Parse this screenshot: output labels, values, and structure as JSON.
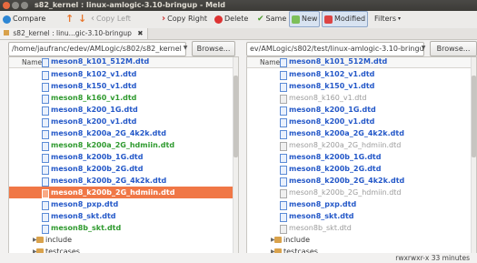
{
  "window": {
    "title": "s82_kernel : linux-amlogic-3.10-bringup - Meld"
  },
  "toolbar": {
    "compare": "Compare",
    "copy_left": "Copy Left",
    "copy_right": "Copy Right",
    "delete": "Delete",
    "same": "Same",
    "new": "New",
    "modified": "Modified",
    "filters": "Filters"
  },
  "tab": {
    "label": "s82_kernel : linu...gic-3.10-bringup",
    "close": "✖"
  },
  "left": {
    "path": "/home/jaufranc/edev/AMLogic/s802/s82_kernel",
    "browse": "Browse...",
    "column": "Name",
    "rows": [
      "meson8_k102_v1.dtd",
      "meson8_k150_v1.dtd",
      "meson8_k160_v1.dtd",
      "meson8_k200_1G.dtd",
      "meson8_k200_v1.dtd",
      "meson8_k200a_2G_4k2k.dtd",
      "meson8_k200a_2G_hdmiin.dtd",
      "meson8_k200b_1G.dtd",
      "meson8_k200b_2G.dtd",
      "meson8_k200b_2G_4k2k.dtd",
      "meson8_k200b_2G_hdmiin.dtd",
      "meson8_pxp.dtd",
      "meson8_skt.dtd",
      "meson8b_skt.dtd"
    ],
    "folders": [
      "include",
      "testcases"
    ]
  },
  "right": {
    "path": "ev/AMLogic/s802/test/linux-amlogic-3.10-bringup",
    "browse": "Browse...",
    "column": "Name",
    "rows": [
      "meson8_k102_v1.dtd",
      "meson8_k150_v1.dtd",
      "meson8_k160_v1.dtd",
      "meson8_k200_1G.dtd",
      "meson8_k200_v1.dtd",
      "meson8_k200a_2G_4k2k.dtd",
      "meson8_k200a_2G_hdmiin.dtd",
      "meson8_k200b_1G.dtd",
      "meson8_k200b_2G.dtd",
      "meson8_k200b_2G_4k2k.dtd",
      "meson8_k200b_2G_hdmiin.dtd",
      "meson8_pxp.dtd",
      "meson8_skt.dtd",
      "meson8b_skt.dtd"
    ],
    "folders": [
      "include",
      "testcases"
    ]
  },
  "status": {
    "text": "rwxrwxr-x  33 minutes"
  },
  "colors": {
    "selection": "#f07746",
    "blue": "#2458c8",
    "green": "#2f9a2f",
    "gray": "#9b9b9b"
  }
}
